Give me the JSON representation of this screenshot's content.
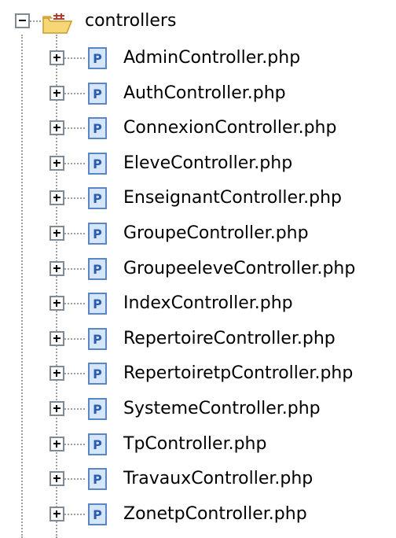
{
  "tree": {
    "root": {
      "label": "controllers",
      "expanded": true,
      "icon": "folder-package-icon"
    },
    "children": [
      {
        "label": "AdminController.php",
        "icon": "php-file-icon",
        "expanded": false
      },
      {
        "label": "AuthController.php",
        "icon": "php-file-icon",
        "expanded": false
      },
      {
        "label": "ConnexionController.php",
        "icon": "php-file-icon",
        "expanded": false
      },
      {
        "label": "EleveController.php",
        "icon": "php-file-icon",
        "expanded": false
      },
      {
        "label": "EnseignantController.php",
        "icon": "php-file-icon",
        "expanded": false
      },
      {
        "label": "GroupeController.php",
        "icon": "php-file-icon",
        "expanded": false
      },
      {
        "label": "GroupeeleveController.php",
        "icon": "php-file-icon",
        "expanded": false
      },
      {
        "label": "IndexController.php",
        "icon": "php-file-icon",
        "expanded": false
      },
      {
        "label": "RepertoireController.php",
        "icon": "php-file-icon",
        "expanded": false
      },
      {
        "label": "RepertoiretpController.php",
        "icon": "php-file-icon",
        "expanded": false
      },
      {
        "label": "SystemeController.php",
        "icon": "php-file-icon",
        "expanded": false
      },
      {
        "label": "TpController.php",
        "icon": "php-file-icon",
        "expanded": false
      },
      {
        "label": "TravauxController.php",
        "icon": "php-file-icon",
        "expanded": false
      },
      {
        "label": "ZonetpController.php",
        "icon": "php-file-icon",
        "expanded": false
      }
    ]
  },
  "colors": {
    "php_icon_border": "#5b86c5",
    "php_icon_fill": "#d6e6fa",
    "php_icon_letter": "#2a5db0",
    "folder_fill": "#f7d676",
    "folder_border": "#c89a2a",
    "package_mark": "#c0392b"
  }
}
